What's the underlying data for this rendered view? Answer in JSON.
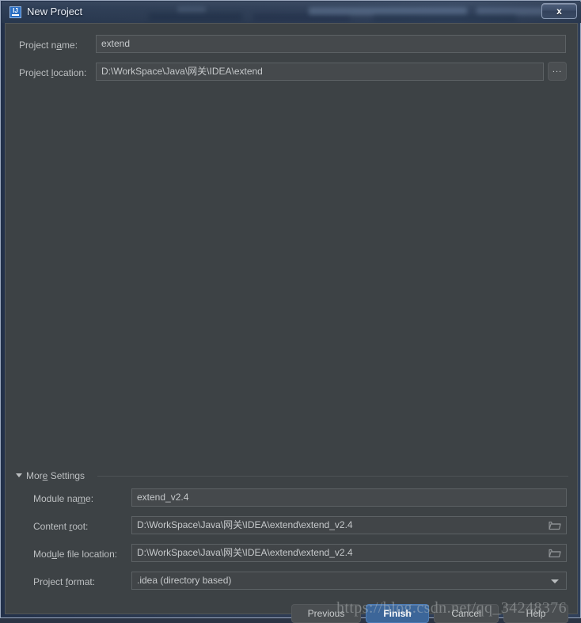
{
  "window": {
    "title": "New Project",
    "icon": "intellij-idea-icon",
    "close_label": "x"
  },
  "form": {
    "project_name": {
      "label_before": "Project n",
      "label_mnemonic": "a",
      "label_after": "me:",
      "value": "extend"
    },
    "project_location": {
      "label_before": "Project ",
      "label_mnemonic": "l",
      "label_after": "ocation:",
      "value": "D:\\WorkSpace\\Java\\网关\\IDEA\\extend",
      "browse_label": "..."
    }
  },
  "more_settings": {
    "label_before": "Mor",
    "label_mnemonic": "e",
    "label_after": " Settings",
    "expanded": true,
    "module_name": {
      "label_before": "Module na",
      "label_mnemonic": "m",
      "label_after": "e:",
      "value": "extend_v2.4"
    },
    "content_root": {
      "label_before": "Content ",
      "label_mnemonic": "r",
      "label_after": "oot:",
      "value": "D:\\WorkSpace\\Java\\网关\\IDEA\\extend\\extend_v2.4",
      "browse_icon": "folder-icon"
    },
    "module_file_location": {
      "label_before": "Mod",
      "label_mnemonic": "u",
      "label_after": "le file location:",
      "value": "D:\\WorkSpace\\Java\\网关\\IDEA\\extend\\extend_v2.4",
      "browse_icon": "folder-icon"
    },
    "project_format": {
      "label_before": "Project ",
      "label_mnemonic": "f",
      "label_after": "ormat:",
      "value": ".idea (directory based)"
    }
  },
  "buttons": {
    "previous": "Previous",
    "finish": "Finish",
    "cancel": "Cancel",
    "help": "Help"
  },
  "watermark": "https://blog.csdn.net/qq_34248376",
  "colors": {
    "dialog_bg": "#3d4245",
    "field_bg": "#45494c",
    "text": "#bcbfc1",
    "primary_button": "#3c6699",
    "titlebar": "#2e3e57"
  }
}
